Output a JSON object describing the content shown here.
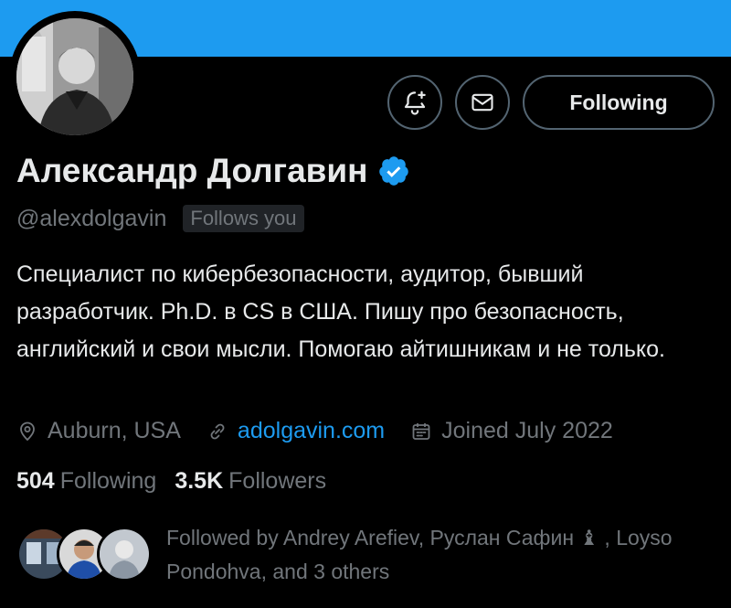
{
  "profile": {
    "name": "Александр Долгавин",
    "handle": "@alexdolgavin",
    "follows_you": "Follows you",
    "bio": "Специалист по кибербезопасности, аудитор, бывший разработчик. Ph.D. в CS в США. Пишу про безопасность, английский и свои мысли. Помогаю айтишникам и не только.",
    "location": "Auburn, USA",
    "website": "adolgavin.com",
    "joined": "Joined July 2022"
  },
  "actions": {
    "notify_icon": "bell-plus-icon",
    "message_icon": "mail-icon",
    "follow_label": "Following"
  },
  "stats": {
    "following_count": "504",
    "following_label": "Following",
    "followers_count": "3.5K",
    "followers_label": "Followers"
  },
  "followed_by": {
    "text": "Followed by Andrey Arefiev, Руслан Сафин ♝ , Loyso Pondohva, and 3 others"
  },
  "colors": {
    "banner": "#1d9bf0",
    "accent": "#1d9bf0",
    "background": "#000000",
    "text_primary": "#e7e9ea",
    "text_secondary": "#71767b"
  }
}
